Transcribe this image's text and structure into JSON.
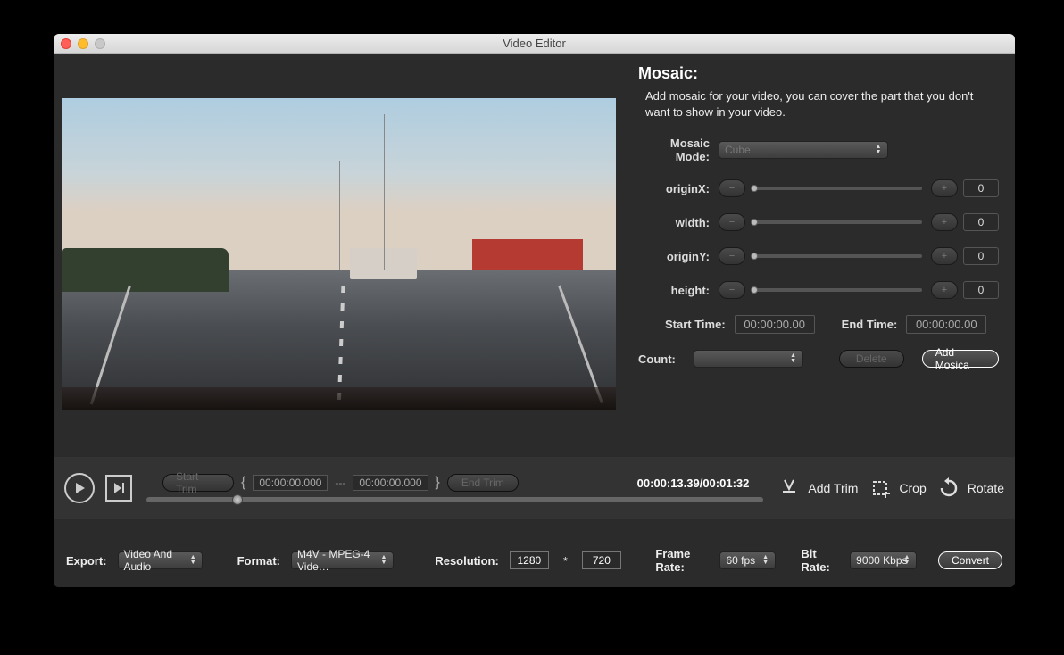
{
  "window": {
    "title": "Video Editor"
  },
  "mosaic": {
    "heading": "Mosaic:",
    "description": "Add mosaic for your video, you can cover the part that you don't want to show in your video.",
    "mode_label": "Mosaic Mode:",
    "mode_value": "Cube",
    "params": {
      "originX": {
        "label": "originX:",
        "value": "0"
      },
      "width": {
        "label": "width:",
        "value": "0"
      },
      "originY": {
        "label": "originY:",
        "value": "0"
      },
      "height": {
        "label": "height:",
        "value": "0"
      }
    },
    "start_time_label": "Start Time:",
    "start_time_value": "00:00:00.00",
    "end_time_label": "End Time:",
    "end_time_value": "00:00:00.00",
    "count_label": "Count:",
    "delete_label": "Delete",
    "add_label": "Add Mosica"
  },
  "playbar": {
    "start_trim_btn": "Start Trim",
    "end_trim_btn": "End Trim",
    "tc_start": "00:00:00.000",
    "tc_end": "00:00:00.000",
    "time_readout": "00:00:13.39/00:01:32",
    "add_trim": "Add Trim",
    "crop": "Crop",
    "rotate": "Rotate",
    "progress_percent": 14.7
  },
  "export": {
    "export_label": "Export:",
    "export_value": "Video And Audio",
    "format_label": "Format:",
    "format_value": "M4V - MPEG-4 Vide…",
    "resolution_label": "Resolution:",
    "res_w": "1280",
    "res_h": "720",
    "framerate_label": "Frame Rate:",
    "framerate_value": "60 fps",
    "bitrate_label": "Bit Rate:",
    "bitrate_value": "9000 Kbps",
    "convert_label": "Convert"
  }
}
